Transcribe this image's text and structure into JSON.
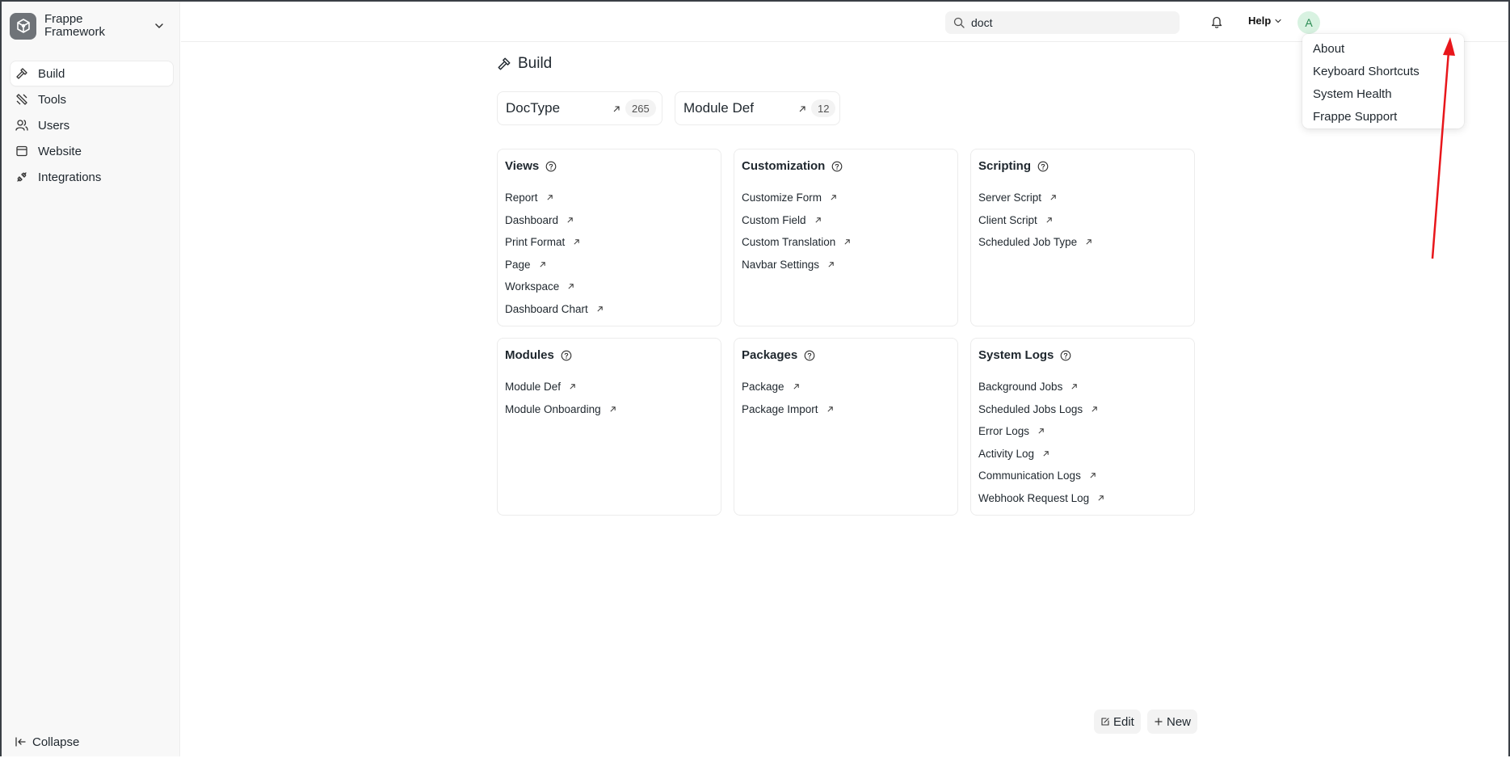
{
  "app": {
    "name_line1": "Frappe",
    "name_line2": "Framework"
  },
  "sidebar": {
    "items": [
      {
        "label": "Build",
        "icon": "hammer-icon"
      },
      {
        "label": "Tools",
        "icon": "tools-icon"
      },
      {
        "label": "Users",
        "icon": "users-icon"
      },
      {
        "label": "Website",
        "icon": "website-icon"
      },
      {
        "label": "Integrations",
        "icon": "integrations-icon"
      }
    ],
    "collapse_label": "Collapse"
  },
  "topbar": {
    "search_value": "doct",
    "help_label": "Help",
    "avatar_initial": "A"
  },
  "help_menu": {
    "items": [
      "About",
      "Keyboard Shortcuts",
      "System Health",
      "Frappe Support"
    ]
  },
  "page": {
    "title": "Build"
  },
  "shortcuts": [
    {
      "label": "DocType",
      "count": "265"
    },
    {
      "label": "Module Def",
      "count": "12"
    }
  ],
  "cards": [
    {
      "title": "Views",
      "links": [
        "Report",
        "Dashboard",
        "Print Format",
        "Page",
        "Workspace",
        "Dashboard Chart"
      ]
    },
    {
      "title": "Customization",
      "links": [
        "Customize Form",
        "Custom Field",
        "Custom Translation",
        "Navbar Settings"
      ]
    },
    {
      "title": "Scripting",
      "links": [
        "Server Script",
        "Client Script",
        "Scheduled Job Type"
      ]
    },
    {
      "title": "Modules",
      "links": [
        "Module Def",
        "Module Onboarding"
      ]
    },
    {
      "title": "Packages",
      "links": [
        "Package",
        "Package Import"
      ]
    },
    {
      "title": "System Logs",
      "links": [
        "Background Jobs",
        "Scheduled Jobs Logs",
        "Error Logs",
        "Activity Log",
        "Communication Logs",
        "Webhook Request Log"
      ]
    }
  ],
  "actions": {
    "edit_label": "Edit",
    "new_label": "New"
  },
  "colors": {
    "annotation_arrow": "#e8161b",
    "avatar_bg": "#d8f2e1"
  }
}
